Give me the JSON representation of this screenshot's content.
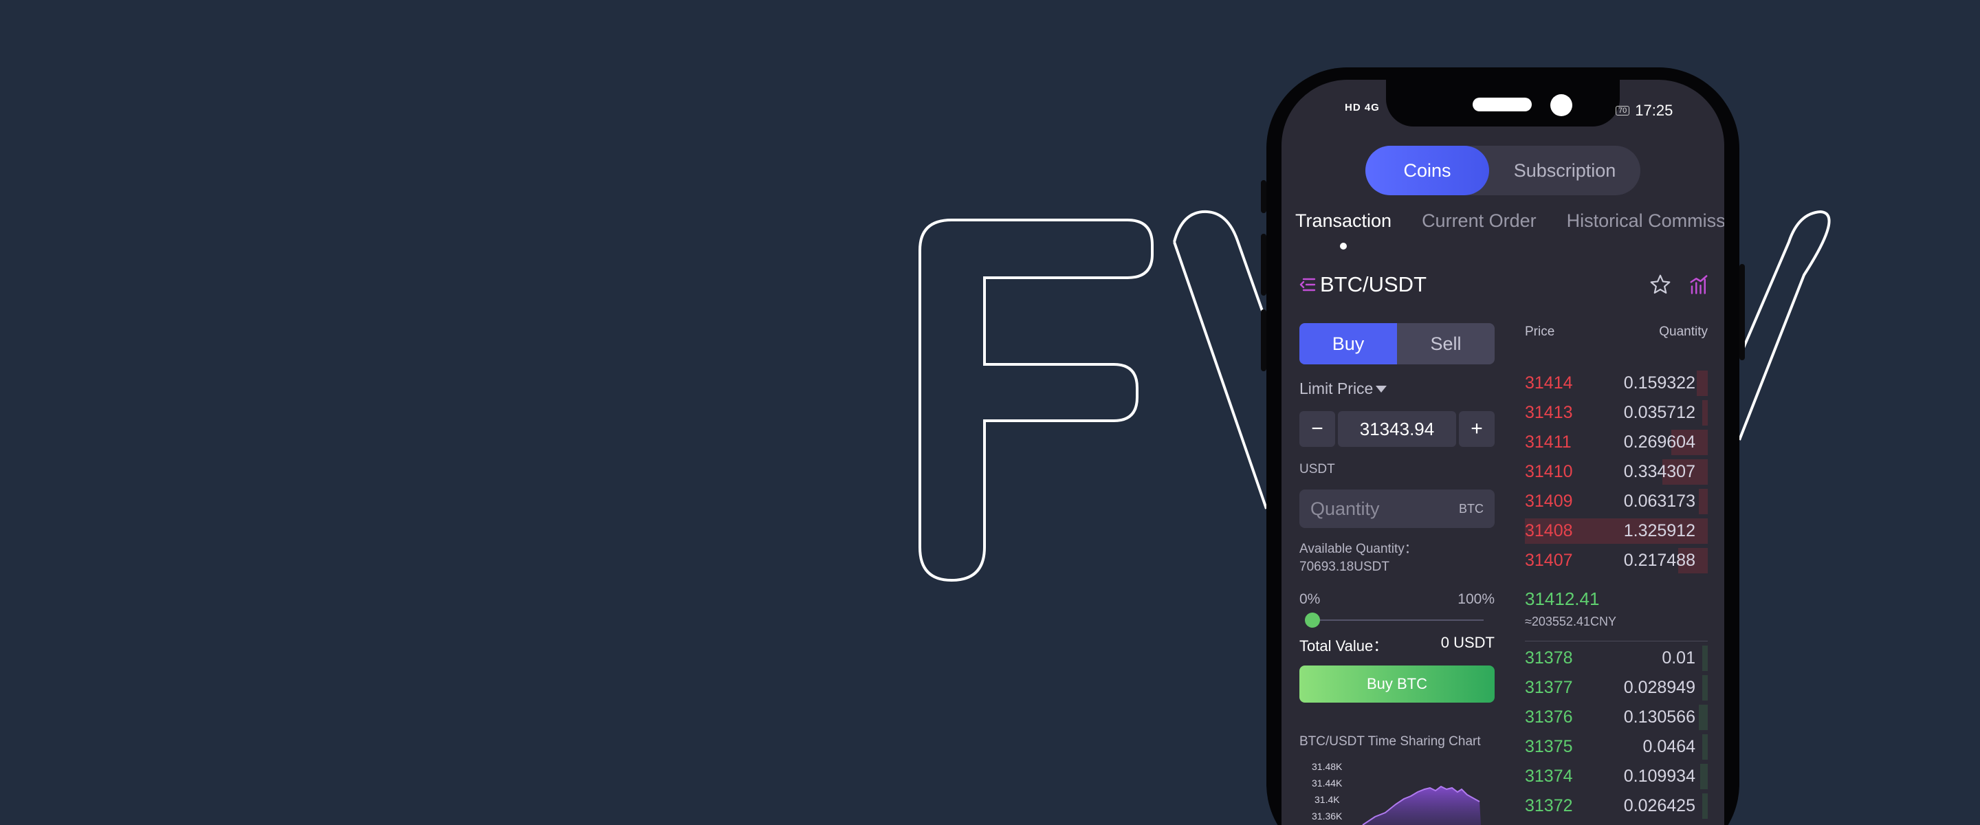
{
  "status_bar": {
    "network": "HD 4G",
    "battery": "70",
    "time": "17:25"
  },
  "segment": {
    "options": [
      "Coins",
      "Subscription"
    ],
    "active": "Coins"
  },
  "tabs": [
    {
      "label": "Transaction",
      "active": true
    },
    {
      "label": "Current Order",
      "active": false
    },
    {
      "label": "Historical Commission",
      "active": false
    }
  ],
  "pair": {
    "name": "BTC/USDT"
  },
  "trade": {
    "buy_label": "Buy",
    "sell_label": "Sell",
    "order_type": "Limit Price",
    "price": "31343.94",
    "minus": "−",
    "plus": "+",
    "price_unit": "USDT",
    "quantity_placeholder": "Quantity",
    "quantity_unit": "BTC",
    "available_label": "Available Quantity：",
    "available_value": "70693.18USDT",
    "pct_min": "0%",
    "pct_max": "100%",
    "slider_fraction": 0,
    "total_label": "Total Value：",
    "total_value": "0 USDT",
    "submit_label": "Buy BTC"
  },
  "chart": {
    "title": "BTC/USDT Time Sharing Chart",
    "y_ticks": [
      "31.48K",
      "31.44K",
      "31.4K",
      "31.36K"
    ]
  },
  "order_book": {
    "price_header": "Price",
    "quantity_header": "Quantity",
    "asks": [
      {
        "price": "31414",
        "qty": "0.159322",
        "depth": 0.06
      },
      {
        "price": "31413",
        "qty": "0.035712",
        "depth": 0.03
      },
      {
        "price": "31411",
        "qty": "0.269604",
        "depth": 0.2
      },
      {
        "price": "31410",
        "qty": "0.334307",
        "depth": 0.25
      },
      {
        "price": "31409",
        "qty": "0.063173",
        "depth": 0.05
      },
      {
        "price": "31408",
        "qty": "1.325912",
        "depth": 1.0
      },
      {
        "price": "31407",
        "qty": "0.217488",
        "depth": 0.16
      }
    ],
    "last_price": "31412.41",
    "last_price_cny": "≈203552.41CNY",
    "bids": [
      {
        "price": "31378",
        "qty": "0.01",
        "depth": 0.0
      },
      {
        "price": "31377",
        "qty": "0.028949",
        "depth": 0.02
      },
      {
        "price": "31376",
        "qty": "0.130566",
        "depth": 0.05
      },
      {
        "price": "31375",
        "qty": "0.0464",
        "depth": 0.03
      },
      {
        "price": "31374",
        "qty": "0.109934",
        "depth": 0.04
      },
      {
        "price": "31372",
        "qty": "0.026425",
        "depth": 0.02
      }
    ]
  },
  "colors": {
    "accent": "#4e5ff2",
    "ask": "#e8424c",
    "bid": "#5fcf6f",
    "background": "#222d3f"
  }
}
